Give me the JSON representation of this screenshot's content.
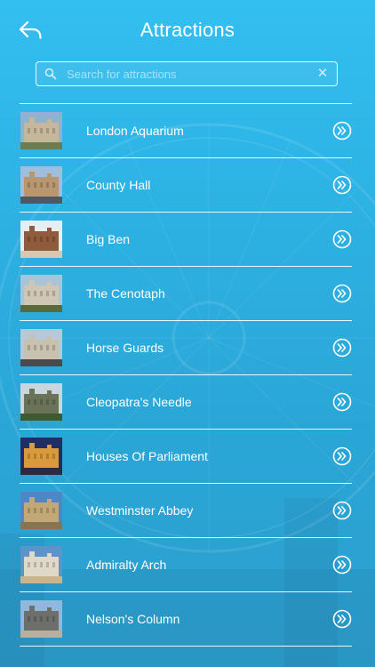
{
  "header": {
    "title": "Attractions",
    "back_icon": "back-arrow-icon"
  },
  "search": {
    "placeholder": "Search for attractions",
    "value": "",
    "search_icon": "search-icon",
    "clear_icon": "clear-icon"
  },
  "attractions": [
    {
      "name": "London Aquarium",
      "thumb_colors": [
        "#8fb3cf",
        "#c7b79a",
        "#6d7d52"
      ]
    },
    {
      "name": "County Hall",
      "thumb_colors": [
        "#9fbede",
        "#b89770",
        "#4d5a60"
      ]
    },
    {
      "name": "Big Ben",
      "thumb_colors": [
        "#e7eef3",
        "#8f5b3c",
        "#d9c8b0"
      ]
    },
    {
      "name": "The Cenotaph",
      "thumb_colors": [
        "#a9c4da",
        "#cfc6b3",
        "#5c6a3a"
      ]
    },
    {
      "name": "Horse Guards",
      "thumb_colors": [
        "#b7c9d9",
        "#c9c1b0",
        "#4a4a4a"
      ]
    },
    {
      "name": "Cleopatra's Needle",
      "thumb_colors": [
        "#c9d6dd",
        "#6a7258",
        "#3f5a2f"
      ]
    },
    {
      "name": "Houses Of Parliament",
      "thumb_colors": [
        "#1f2e63",
        "#d89a3a",
        "#2a2a40"
      ]
    },
    {
      "name": "Westminster Abbey",
      "thumb_colors": [
        "#4f86c6",
        "#c3a877",
        "#8a7354"
      ]
    },
    {
      "name": "Admiralty Arch",
      "thumb_colors": [
        "#5e93c9",
        "#e0d8c8",
        "#c9b48c"
      ]
    },
    {
      "name": "Nelson's Column",
      "thumb_colors": [
        "#8fb8dc",
        "#6e6e6a",
        "#b7b0a0"
      ]
    }
  ],
  "row_action_icon": "chevron-right-circle-icon"
}
